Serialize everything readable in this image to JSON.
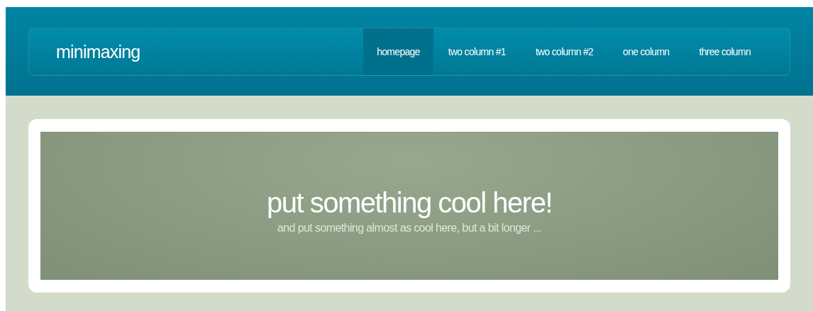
{
  "header": {
    "logo": "minimaxing",
    "nav": [
      {
        "label": "homepage",
        "selected": true
      },
      {
        "label": "two column #1",
        "selected": false
      },
      {
        "label": "two column #2",
        "selected": false
      },
      {
        "label": "one column",
        "selected": false
      },
      {
        "label": "three column",
        "selected": false
      }
    ]
  },
  "banner": {
    "title": "put something cool here!",
    "subtitle": "and put something almost as cool here, but a bit longer ..."
  }
}
